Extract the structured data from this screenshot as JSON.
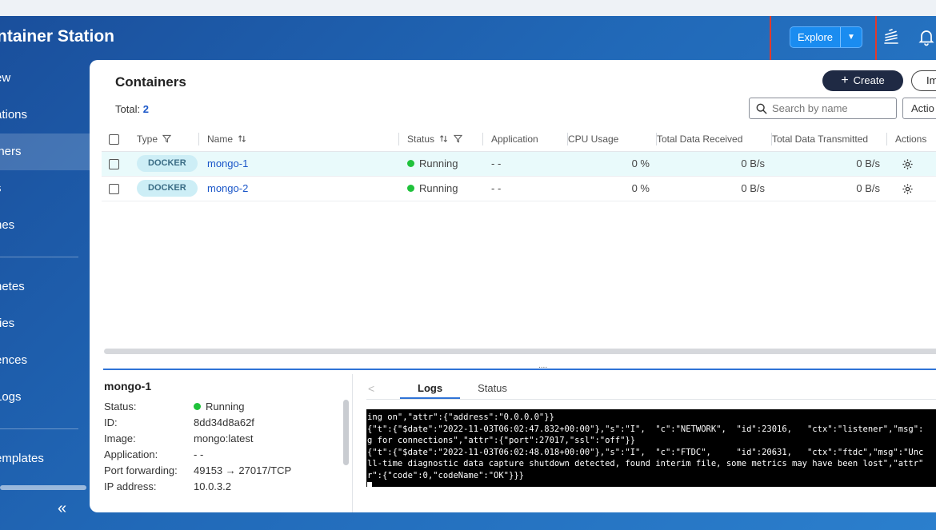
{
  "app": {
    "title": "ntainer Station"
  },
  "header": {
    "explore_label": "Explore"
  },
  "sidebar": {
    "items": [
      {
        "label": "ew"
      },
      {
        "label": "ations"
      },
      {
        "label": "iners"
      },
      {
        "label": "s"
      },
      {
        "label": "nes"
      },
      {
        "label": "netes"
      },
      {
        "label": "ries"
      },
      {
        "label": "ences"
      },
      {
        "label": "Logs"
      },
      {
        "label": "emplates"
      }
    ],
    "collapse_glyph": "«"
  },
  "containers": {
    "title": "Containers",
    "total_label": "Total:",
    "total_value": "2",
    "create_label": "Create",
    "import_label": "Im",
    "search_placeholder": "Search by name",
    "action_label": "Actio",
    "columns": {
      "type": "Type",
      "name": "Name",
      "status": "Status",
      "application": "Application",
      "cpu": "CPU Usage",
      "received": "Total Data Received",
      "transmitted": "Total Data Transmitted",
      "actions": "Actions"
    },
    "rows": [
      {
        "type": "DOCKER",
        "name": "mongo-1",
        "status": "Running",
        "application": "- -",
        "cpu": "0 %",
        "received": "0 B/s",
        "transmitted": "0 B/s"
      },
      {
        "type": "DOCKER",
        "name": "mongo-2",
        "status": "Running",
        "application": "- -",
        "cpu": "0 %",
        "received": "0 B/s",
        "transmitted": "0 B/s"
      }
    ]
  },
  "details": {
    "title": "mongo-1",
    "status_label": "Status:",
    "status_value": "Running",
    "id_label": "ID:",
    "id_value": "8dd34d8a62f",
    "image_label": "Image:",
    "image_value": "mongo:latest",
    "application_label": "Application:",
    "application_value": "- -",
    "port_label": "Port forwarding:",
    "port_value": "49153 → 27017/TCP",
    "ip_label": "IP address:",
    "ip_value": "10.0.3.2",
    "tabs": {
      "logs": "Logs",
      "status": "Status"
    },
    "logs": [
      "ing on\",\"attr\":{\"address\":\"0.0.0.0\"}}",
      "{\"t\":{\"$date\":\"2022-11-03T06:02:47.832+00:00\"},\"s\":\"I\",  \"c\":\"NETWORK\",  \"id\":23016,   \"ctx\":\"listener\",\"msg\":",
      "g for connections\",\"attr\":{\"port\":27017,\"ssl\":\"off\"}}",
      "{\"t\":{\"$date\":\"2022-11-03T06:02:48.018+00:00\"},\"s\":\"I\",  \"c\":\"FTDC\",     \"id\":20631,   \"ctx\":\"ftdc\",\"msg\":\"Unc",
      "ll-time diagnostic data capture shutdown detected, found interim file, some metrics may have been lost\",\"attr\"",
      "r\":{\"code\":0,\"codeName\":\"OK\"}}}"
    ]
  },
  "colors": {
    "accent": "#1a8cf0",
    "running": "#1fc23b",
    "highlight": "#e23a2c"
  }
}
